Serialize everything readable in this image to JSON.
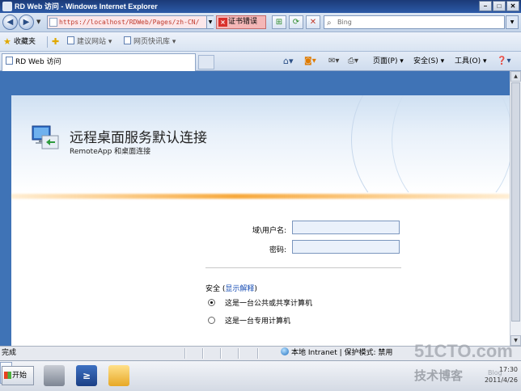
{
  "window": {
    "title": "RD Web 访问 - Windows Internet Explorer",
    "min_label": "–",
    "max_label": "□",
    "close_label": "✕"
  },
  "nav": {
    "back_icon": "back-arrow-icon",
    "forward_icon": "forward-arrow-icon",
    "address_value": "https://localhost/RDWeb/Pages/zh-CN/",
    "cert_error_label": "证书错误",
    "search_placeholder": "Bing"
  },
  "favorites": {
    "label": "收藏夹",
    "items": [
      {
        "label": "建议网站 ▾"
      },
      {
        "label": "网页快讯库 ▾"
      }
    ]
  },
  "tab": {
    "title": "RD Web 访问"
  },
  "commands": {
    "page": "页面(P) ▾",
    "safety": "安全(S) ▾",
    "tools": "工具(O) ▾"
  },
  "page": {
    "title": "远程桌面服务默认连接",
    "subtitle": "RemoteApp 和桌面连接",
    "username_label": "域\\用户名:",
    "password_label": "密码:",
    "security_label": "安全 (",
    "security_link": "显示解释",
    "security_close": ")",
    "option_public": "这是一台公共或共享计算机",
    "option_private": "这是一台专用计算机",
    "selected_option": "public"
  },
  "status": {
    "text": "完成",
    "zone": "本地 Intranet | 保护模式: 禁用"
  },
  "taskbar": {
    "start_label": "开始",
    "clock_time": "17:30",
    "clock_date": "2011/4/26"
  },
  "watermark": {
    "site": "51CTO.com",
    "tagline": "技术博客",
    "blog": "Blog"
  },
  "colors": {
    "accent_blue": "#3f73b6",
    "link_blue": "#1a4fb5",
    "orange_glow": "#f7a83a"
  }
}
